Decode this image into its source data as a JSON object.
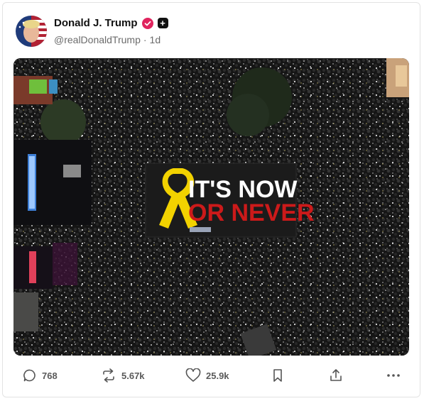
{
  "post": {
    "author_name": "Donald J. Trump",
    "handle": "@realDonaldTrump",
    "separator": "·",
    "time": "1d",
    "badges": [
      "verified-icon",
      "plus-icon"
    ]
  },
  "media": {
    "banner_line1": "IT'S NOW",
    "banner_line2": "OR NEVER",
    "ribbon_color": "#f2d200",
    "accent_red": "#cc1a1a"
  },
  "actions": {
    "replies": "768",
    "reposts": "5.67k",
    "likes": "25.9k"
  }
}
